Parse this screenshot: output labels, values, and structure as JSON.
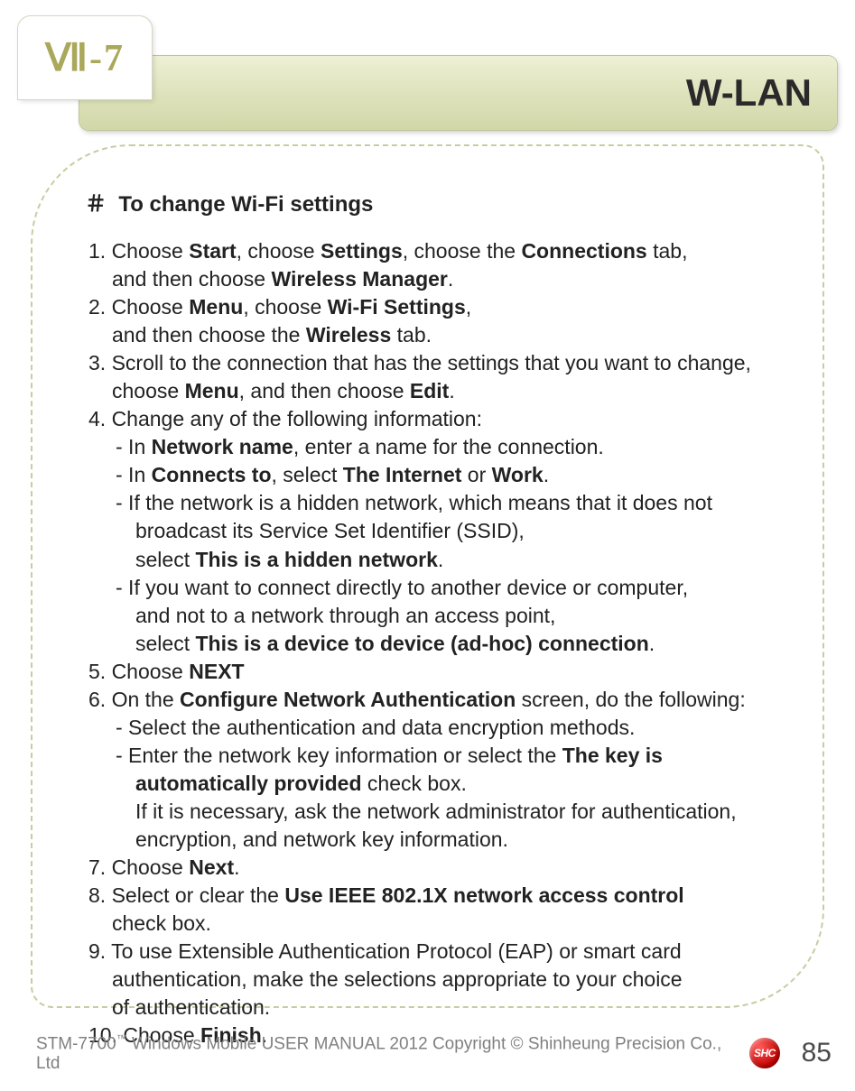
{
  "chapter": "Ⅶ-7",
  "title": "W-LAN",
  "section_marker": "＃",
  "section_heading": "To change Wi-Fi settings",
  "steps": {
    "s1a": "1. Choose ",
    "s1b": "Start",
    "s1c": ", choose ",
    "s1d": "Settings",
    "s1e": ", choose the ",
    "s1f": "Connections",
    "s1g": " tab,",
    "s1h": "and then choose ",
    "s1i": "Wireless Manager",
    "s1j": ".",
    "s2a": "2. Choose ",
    "s2b": "Menu",
    "s2c": ", choose ",
    "s2d": "Wi-Fi Settings",
    "s2e": ",",
    "s2f": "and  then choose the ",
    "s2g": "Wireless",
    "s2h": " tab.",
    "s3a": "3. Scroll to the connection that has the settings that you want to change,",
    "s3b": "choose ",
    "s3c": "Menu",
    "s3d": ", and then choose ",
    "s3e": "Edit",
    "s3f": ".",
    "s4a": "4. Change any of the following information:",
    "s4s1a": "-  In ",
    "s4s1b": "Network name",
    "s4s1c": ", enter a name for the connection.",
    "s4s2a": "-  In ",
    "s4s2b": "Connects to",
    "s4s2c": ", select ",
    "s4s2d": "The Internet",
    "s4s2e": " or ",
    "s4s2f": "Work",
    "s4s2g": ".",
    "s4s3a": "-  If the network is a hidden network, which means that it does not",
    "s4s3b": "broadcast its Service Set Identifier (SSID),",
    "s4s3c": "select ",
    "s4s3d": "This is a hidden network",
    "s4s3e": ".",
    "s4s4a": "-  If you want to connect directly to another device or computer,",
    "s4s4b": "and not to a network through an access point,",
    "s4s4c": "select ",
    "s4s4d": "This is a device to device (ad-hoc) connection",
    "s4s4e": ".",
    "s5a": "5. Choose ",
    "s5b": "NEXT",
    "s6a": "6. ",
    "s6b": "On the ",
    "s6c": "Configure Network Authentication",
    "s6d": " screen, do the following:",
    "s6s1": "-  Select the authentication and data encryption methods.",
    "s6s2a": "-  Enter the network key information or select the ",
    "s6s2b": "The key is",
    "s6s2c": "automatically provided",
    "s6s2d": " check box.",
    "s6s2e": "If it is necessary, ask the network administrator for authentication,",
    "s6s2f": "encryption, and network key information.",
    "s7a": "7. Choose ",
    "s7b": "Next",
    "s7c": ".",
    "s8a": "8. Select or clear the ",
    "s8b": "Use IEEE 802.1X network access control",
    "s8c": "check box.",
    "s9a": "9. To use Extensible Authentication Protocol (EAP) or smart card",
    "s9b": "authentication, make the selections appropriate to your choice",
    "s9c": "of authentication.",
    "s10a": "10. Choose ",
    "s10b": "Finish",
    "s10c": "."
  },
  "footer": {
    "product": "STM-7700",
    "tm": "™",
    "rest": " Windows Mobile USER MANUAL  2012 Copyright © Shinheung Precision Co., Ltd",
    "logo": "SHC",
    "page": "85"
  }
}
